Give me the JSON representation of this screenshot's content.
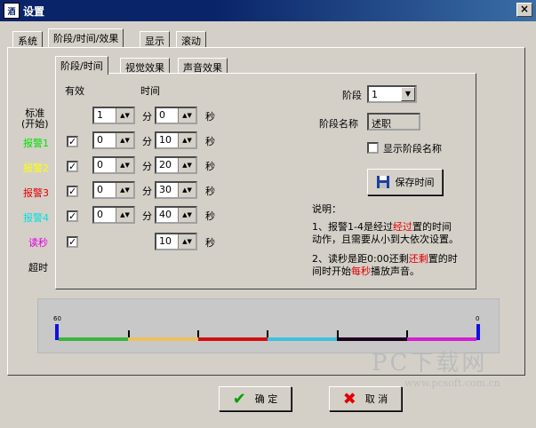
{
  "window": {
    "title": "设置",
    "icon_text": "酒"
  },
  "tabs": [
    "系统",
    "阶段/时间/效果",
    "显示",
    "滚动"
  ],
  "subtabs": [
    "阶段/时间",
    "视觉效果",
    "声音效果"
  ],
  "headers": {
    "enabled": "有效",
    "time": "时间"
  },
  "rows": [
    {
      "label": "标准\n(开始)",
      "color": "#000000",
      "checked": false,
      "min": "1",
      "sec": "0"
    },
    {
      "label": "报警1",
      "color": "#00e000",
      "checked": true,
      "min": "0",
      "sec": "10"
    },
    {
      "label": "报警2",
      "color": "#ffff00",
      "checked": true,
      "min": "0",
      "sec": "20"
    },
    {
      "label": "报警3",
      "color": "#e00000",
      "checked": true,
      "min": "0",
      "sec": "30"
    },
    {
      "label": "报警4",
      "color": "#00e0e0",
      "checked": true,
      "min": "0",
      "sec": "40"
    },
    {
      "label": "读秒",
      "color": "#e000e0",
      "checked": true,
      "min": "",
      "sec": "10"
    },
    {
      "label": "超时",
      "color": "#000000"
    }
  ],
  "units": {
    "min": "分",
    "sec": "秒"
  },
  "stage": {
    "label": "阶段",
    "value": "1",
    "name_label": "阶段名称",
    "name_value": "述职",
    "show_name_label": "显示阶段名称",
    "show_name_checked": false
  },
  "save_button": "保存时间",
  "note": {
    "title": "说明：",
    "p1_a": "1、报警1-4是经过",
    "p1_b": "经过",
    "p1_c": "置的时间",
    "p1_line2": "动作，且需要从小到大依次设置。",
    "p2_a": "2、读秒是距0:00还剩",
    "p2_b": "还剩",
    "p2_c": "置的时",
    "p2_line2a": "间时开始",
    "p2_line2b": "每秒",
    "p2_line2c": "播放声音。"
  },
  "timeline": {
    "start_label": "60",
    "end_label": "0",
    "segments": [
      "#3cb43c",
      "#f0c060",
      "#d01010",
      "#40c0e0",
      "#200020",
      "#d020d0"
    ]
  },
  "buttons": {
    "ok": "确 定",
    "cancel": "取 消"
  },
  "watermark": {
    "text": "PC下载网",
    "url": "www.pcsoft.com.cn"
  }
}
